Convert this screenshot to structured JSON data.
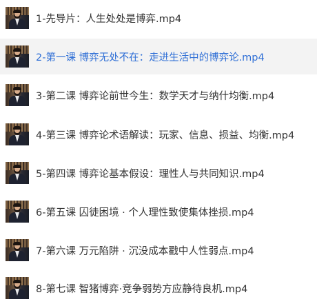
{
  "playlist": {
    "active_index": 1,
    "items": [
      {
        "title": "1-先导片：人生处处是博弈.mp4",
        "thumbnail_icon": "video-thumbnail-icon"
      },
      {
        "title": "2-第一课 博弈无处不在：走进生活中的博弈论.mp4",
        "thumbnail_icon": "video-thumbnail-icon"
      },
      {
        "title": "3-第二课 博弈论前世今生：数学天才与纳什均衡.mp4",
        "thumbnail_icon": "video-thumbnail-icon"
      },
      {
        "title": "4-第三课 博弈论术语解读：玩家、信息、损益、均衡.mp4",
        "thumbnail_icon": "video-thumbnail-icon"
      },
      {
        "title": "5-第四课 博弈论基本假设：理性人与共同知识.mp4",
        "thumbnail_icon": "video-thumbnail-icon"
      },
      {
        "title": "6-第五课 囚徒困境 · 个人理性致使集体挫损.mp4",
        "thumbnail_icon": "video-thumbnail-icon"
      },
      {
        "title": "7-第六课 万元陷阱 · 沉没成本戳中人性弱点.mp4",
        "thumbnail_icon": "video-thumbnail-icon"
      },
      {
        "title": "8-第七课 智猪博弈·竞争弱势方应静待良机.mp4",
        "thumbnail_icon": "video-thumbnail-icon"
      }
    ],
    "colors": {
      "active_text": "#2f6fd6",
      "active_background": "#f3f3f3",
      "text": "#333333"
    }
  }
}
